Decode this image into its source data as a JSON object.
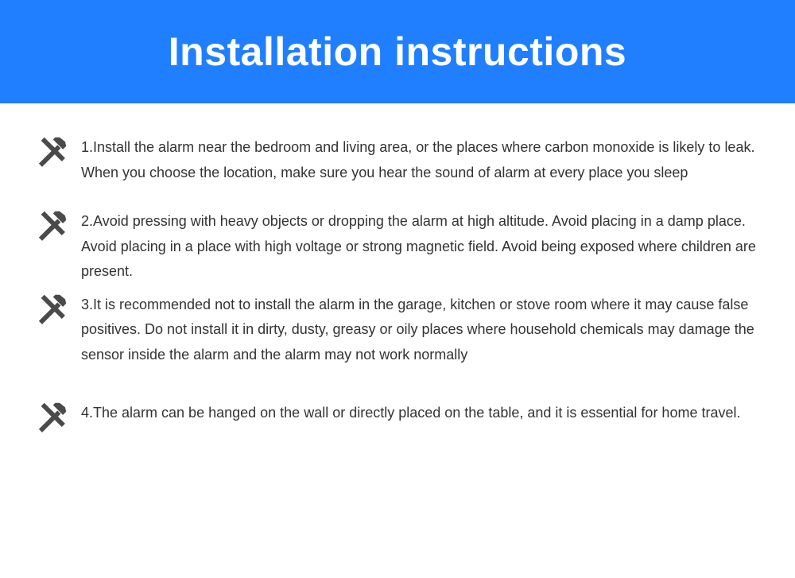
{
  "title": "Installation instructions",
  "items": [
    "1.Install the alarm near the bedroom and living area, or the places where carbon monoxide is likely to leak. When you choose the location, make sure you hear the sound of alarm at every place you sleep",
    "2.Avoid pressing with heavy objects or dropping the alarm at high altitude. Avoid placing in a damp place. Avoid placing in a place with high voltage or strong magnetic field. Avoid being exposed where children are present.",
    "3.It is recommended not to install the alarm in the garage, kitchen or stove room where it may cause false positives. Do not install it in dirty, dusty, greasy or oily places where household chemicals may damage the sensor inside the alarm and the alarm may not work normally",
    "4.The alarm can be hanged on the wall or directly placed on the table, and it is essential for home travel."
  ]
}
